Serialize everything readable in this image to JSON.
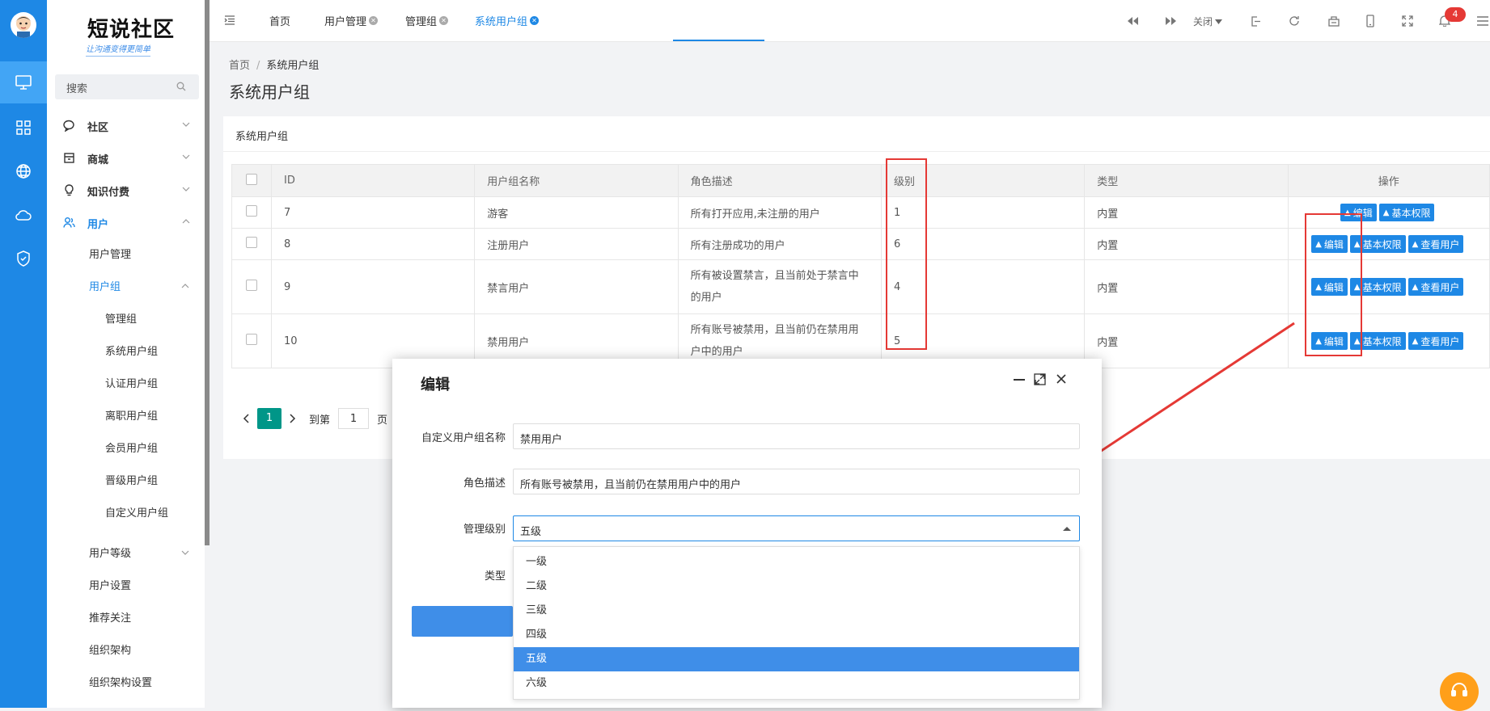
{
  "brand": {
    "title": "短说社区",
    "slogan": "让沟通变得更简单"
  },
  "rail": {
    "icons": [
      "avatar",
      "monitor-icon",
      "grid-icon",
      "globe-icon",
      "cloud-icon",
      "shield-check-icon"
    ]
  },
  "sidebar": {
    "search_placeholder": "搜索",
    "groups": [
      {
        "label": "社区",
        "icon": "chat-icon"
      },
      {
        "label": "商城",
        "icon": "shop-icon"
      },
      {
        "label": "知识付费",
        "icon": "bulb-icon"
      },
      {
        "label": "用户",
        "icon": "users-icon"
      }
    ],
    "user_items": [
      "用户管理",
      "用户组"
    ],
    "usergroup_items": [
      "管理组",
      "系统用户组",
      "认证用户组",
      "离职用户组",
      "会员用户组",
      "晋级用户组",
      "自定义用户组"
    ],
    "more_items": [
      "用户等级",
      "用户设置",
      "推荐关注",
      "组织架构",
      "组织架构设置"
    ]
  },
  "tabs": [
    "首页",
    "用户管理",
    "管理组",
    "系统用户组"
  ],
  "toolbar": {
    "close_label": "关闭",
    "notification_count": "4"
  },
  "breadcrumb": {
    "home": "首页",
    "sep": "/",
    "current": "系统用户组"
  },
  "page": {
    "title": "系统用户组",
    "card_title": "系统用户组"
  },
  "table": {
    "headers": [
      "ID",
      "用户组名称",
      "角色描述",
      "级别",
      "类型",
      "操作"
    ],
    "rows": [
      {
        "id": "7",
        "name": "游客",
        "desc": "所有打开应用,未注册的用户",
        "level": "1",
        "type": "内置"
      },
      {
        "id": "8",
        "name": "注册用户",
        "desc": "所有注册成功的用户",
        "level": "6",
        "type": "内置"
      },
      {
        "id": "9",
        "name": "禁言用户",
        "desc": "所有被设置禁言，且当前处于禁言中的用户",
        "level": "4",
        "type": "内置"
      },
      {
        "id": "10",
        "name": "禁用用户",
        "desc": "所有账号被禁用，且当前仍在禁用用户中的用户",
        "level": "5",
        "type": "内置"
      }
    ],
    "actions": {
      "edit": "编辑",
      "perm": "基本权限",
      "view": "查看用户"
    }
  },
  "pager": {
    "page": "1",
    "goto_label": "到第",
    "goto_value": "1",
    "suffix": "页"
  },
  "dialog": {
    "title": "编辑",
    "fields": {
      "name_label": "自定义用户组名称",
      "name_value": "禁用用户",
      "desc_label": "角色描述",
      "desc_value": "所有账号被禁用，且当前仍在禁用用户中的用户",
      "level_label": "管理级别",
      "level_value": "五级",
      "type_label": "类型"
    },
    "options": [
      "一级",
      "二级",
      "三级",
      "四级",
      "五级",
      "六级"
    ],
    "selected_option": "五级"
  },
  "colors": {
    "primary": "#1e88e5",
    "annotation_red": "#e53935",
    "pager_green": "#009688",
    "support_orange": "#ff9f1a"
  }
}
